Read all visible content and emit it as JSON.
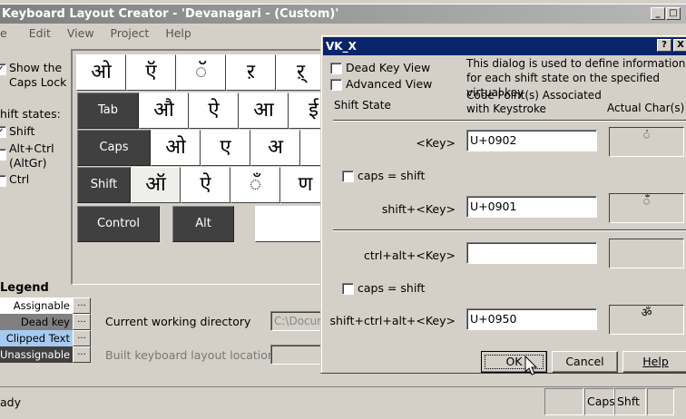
{
  "window": {
    "title": "Keyboard Layout Creator - 'Devanagari - (Custom)'"
  },
  "menu": [
    "e",
    "Edit",
    "View",
    "Project",
    "Help"
  ],
  "options": {
    "show_caps": "Show the Caps Lock",
    "shift_states": "hift states:",
    "shift": "Shift",
    "altctrl": "Alt+Ctrl (AltGr)",
    "ctrl": "Ctrl"
  },
  "keyboard": {
    "row1": [
      "ओ",
      "ऍ",
      "ॅ",
      "ऱ",
      "ऱ्"
    ],
    "row2": [
      "Tab",
      "औ",
      "ऐ",
      "आ",
      "ई"
    ],
    "row3": [
      "Caps",
      "ओ",
      "ए",
      "अ"
    ],
    "row4": [
      "Shift",
      "ऑ",
      "ऐ",
      "ँ",
      "ण"
    ],
    "row5": [
      "Control",
      "Alt"
    ]
  },
  "legend": {
    "title": "Legend",
    "items": [
      {
        "label": "Assignable",
        "color": "#ffffff"
      },
      {
        "label": "Dead key",
        "color": "#808080"
      },
      {
        "label": "Clipped Text",
        "color": "#a6caf0"
      },
      {
        "label": "Unassignable",
        "color": "#404040"
      }
    ],
    "dots": "..."
  },
  "paths": {
    "cwd_label": "Current working directory",
    "cwd_value": "C:\\Docum",
    "built_label": "Built keyboard layout location",
    "built_value": ""
  },
  "status": {
    "text": "ady",
    "caps": "Caps",
    "shft": "Shft"
  },
  "dialog": {
    "title": "VK_X",
    "help": "?",
    "close": "X",
    "dead_key_view": "Dead Key View",
    "advanced_view": "Advanced View",
    "description": "This dialog is used to define information for each shift state on the specified virtual key",
    "col_shift_state": "Shift State",
    "col_code": "Code Point(s) Associated with Keystroke",
    "col_actual": "Actual Char(s)",
    "rows": [
      {
        "label": "<Key>",
        "value": "U+0902",
        "char": "ं"
      },
      {
        "label": "shift+<Key>",
        "value": "U+0901",
        "char": "ँ"
      },
      {
        "label": "ctrl+alt+<Key>",
        "value": "",
        "char": ""
      },
      {
        "label": "shift+ctrl+alt+<Key>",
        "value": "U+0950",
        "char": "ॐ"
      }
    ],
    "caps_shift": "caps = shift",
    "ok": "OK",
    "cancel": "Cancel",
    "help_btn": "Help"
  }
}
